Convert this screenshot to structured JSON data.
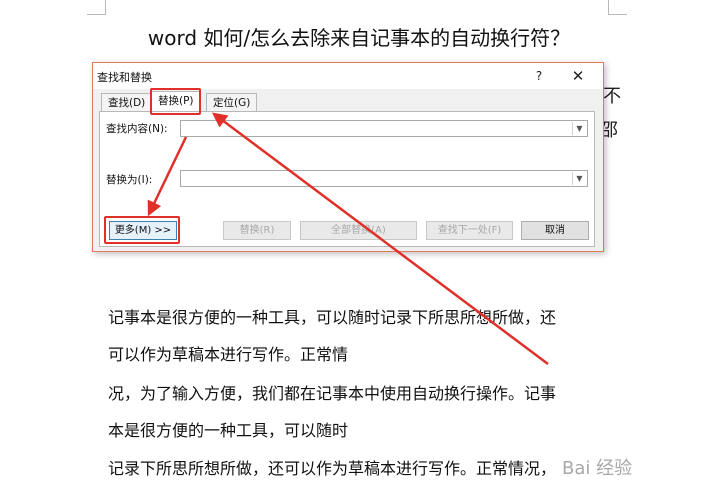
{
  "document": {
    "heading": "word 如何/怎么去除来自记事本的自动换行符？",
    "side_glyph_1": "不",
    "side_glyph_2": "邵",
    "paragraph_lines": [
      "记事本是很方便的一种工具，可以随时记录下所思所想所做，还",
      "可以作为草稿本进行写作。正常情",
      "况，为了输入方便，我们都在记事本中使用自动换行操作。记事",
      "本是很方便的一种工具，可以随时",
      "记录下所思所想所做，还可以作为草稿本进行写作。正常情况，"
    ]
  },
  "dialog": {
    "title": "查找和替换",
    "help_label": "?",
    "close_label": "✕",
    "tabs": [
      {
        "label": "查找(D)"
      },
      {
        "label": "替换(P)"
      },
      {
        "label": "定位(G)"
      }
    ],
    "find_label": "查找内容(N):",
    "find_value": "",
    "replace_label": "替换为(I):",
    "replace_value": "",
    "buttons": {
      "more": "更多(M) >>",
      "replace": "替换(R)",
      "replace_all": "全部替换(A)",
      "find_next": "查找下一处(F)",
      "cancel": "取消"
    }
  },
  "watermark": "Bai 经验",
  "colors": {
    "highlight": "#e0302a",
    "dialog_border": "#e07a5f"
  }
}
